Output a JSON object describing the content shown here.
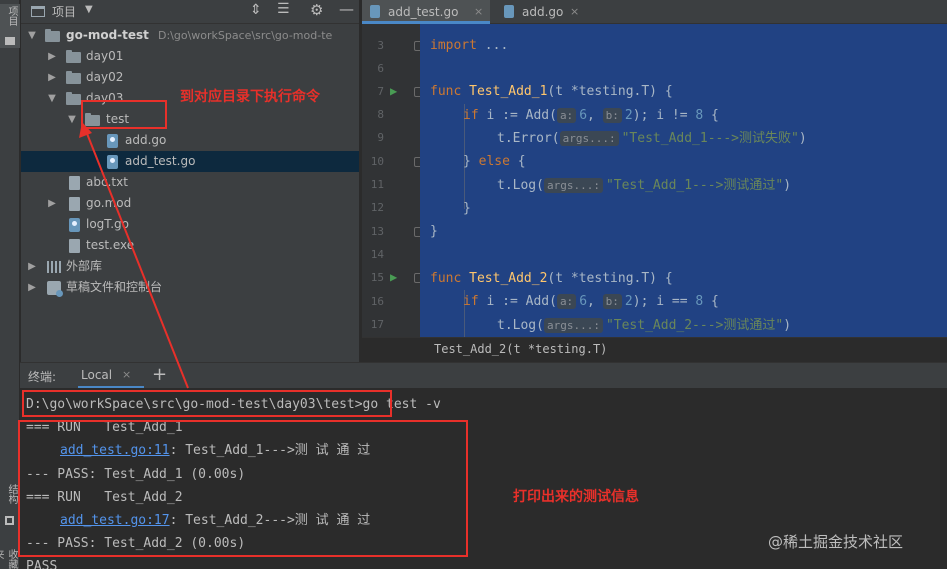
{
  "side_strip": {
    "top_label": "项目",
    "struct_label": "结构",
    "bottom_label": "收藏夹"
  },
  "project": {
    "title": "项目",
    "tree": [
      {
        "label": "go-mod-test",
        "path": "D:\\go\\workSpace\\src\\go-mod-te",
        "kind": "folder",
        "state": "expanded"
      },
      {
        "label": "day01",
        "kind": "folder",
        "state": "collapsed"
      },
      {
        "label": "day02",
        "kind": "folder",
        "state": "collapsed"
      },
      {
        "label": "day03",
        "kind": "folder",
        "state": "expanded"
      },
      {
        "label": "test",
        "kind": "folder",
        "state": "expanded"
      },
      {
        "label": "add.go",
        "kind": "go-file"
      },
      {
        "label": "add_test.go",
        "kind": "go-file",
        "selected": true
      },
      {
        "label": "abc.txt",
        "kind": "text-file"
      },
      {
        "label": "go.mod",
        "kind": "mod-file",
        "state": "collapsed"
      },
      {
        "label": "logT.go",
        "kind": "go-file"
      },
      {
        "label": "test.exe",
        "kind": "exe-file"
      },
      {
        "label": "外部库",
        "kind": "library",
        "state": "collapsed"
      },
      {
        "label": "草稿文件和控制台",
        "kind": "scratch",
        "state": "collapsed"
      }
    ]
  },
  "editor": {
    "tabs": [
      {
        "label": "add_test.go",
        "active": true
      },
      {
        "label": "add.go",
        "active": false
      }
    ],
    "line_numbers": [
      "3",
      "6",
      "7",
      "8",
      "9",
      "10",
      "11",
      "12",
      "13",
      "14",
      "15",
      "16",
      "17"
    ],
    "code": {
      "l3_kw": "import",
      "l3_rest": " ...",
      "l7_kw": "func",
      "l7_fn": "Test_Add_1",
      "l7_rest": "(t *testing.T) {",
      "l8_kw": "if",
      "l8_a": " i := Add(",
      "l8_h1": "a:",
      "l8_n1": "6",
      "l8_c": ", ",
      "l8_h2": "b:",
      "l8_n2": "2",
      "l8_d": "); i != ",
      "l8_n3": "8",
      "l8_e": " {",
      "l9_a": "t.Error(",
      "l9_h": "args...:",
      "l9_s": "\"Test_Add_1--->测试失败\"",
      "l9_b": ")",
      "l10_a": "} ",
      "l10_kw": "else",
      "l10_b": " {",
      "l11_a": "t.Log(",
      "l11_h": "args...:",
      "l11_s": "\"Test_Add_1--->测试通过\"",
      "l11_b": ")",
      "l12": "}",
      "l13": "}",
      "l15_kw": "func",
      "l15_fn": "Test_Add_2",
      "l15_rest": "(t *testing.T) {",
      "l16_kw": "if",
      "l16_a": " i := Add(",
      "l16_h1": "a:",
      "l16_n1": "6",
      "l16_c": ", ",
      "l16_h2": "b:",
      "l16_n2": "2",
      "l16_d": "); i == ",
      "l16_n3": "8",
      "l16_e": " {",
      "l17_a": "t.Log(",
      "l17_h": "args...:",
      "l17_s": "\"Test_Add_2--->测试通过\"",
      "l17_b": ")"
    },
    "breadcrumb": "Test_Add_2(t *testing.T)"
  },
  "terminal": {
    "title": "终端:",
    "tab": "Local",
    "prompt": "D:\\go\\workSpace\\src\\go-mod-test\\day03\\test>",
    "command": "go test -v",
    "lines": {
      "run1": "=== RUN   Test_Add_1",
      "log1_link": "add_test.go:11",
      "log1_text": ": Test_Add_1--->测 试 通 过",
      "pass1": "--- PASS: Test_Add_1 (0.00s)",
      "run2": "=== RUN   Test_Add_2",
      "log2_link": "add_test.go:17",
      "log2_text": ": Test_Add_2--->测 试 通 过",
      "pass2": "--- PASS: Test_Add_2 (0.00s)",
      "final": "PASS"
    }
  },
  "annotations": {
    "dir_note": "到对应目录下执行命令",
    "output_note": "打印出来的测试信息",
    "watermark": "@稀土掘金技术社区",
    "accent": "#e8302a"
  }
}
